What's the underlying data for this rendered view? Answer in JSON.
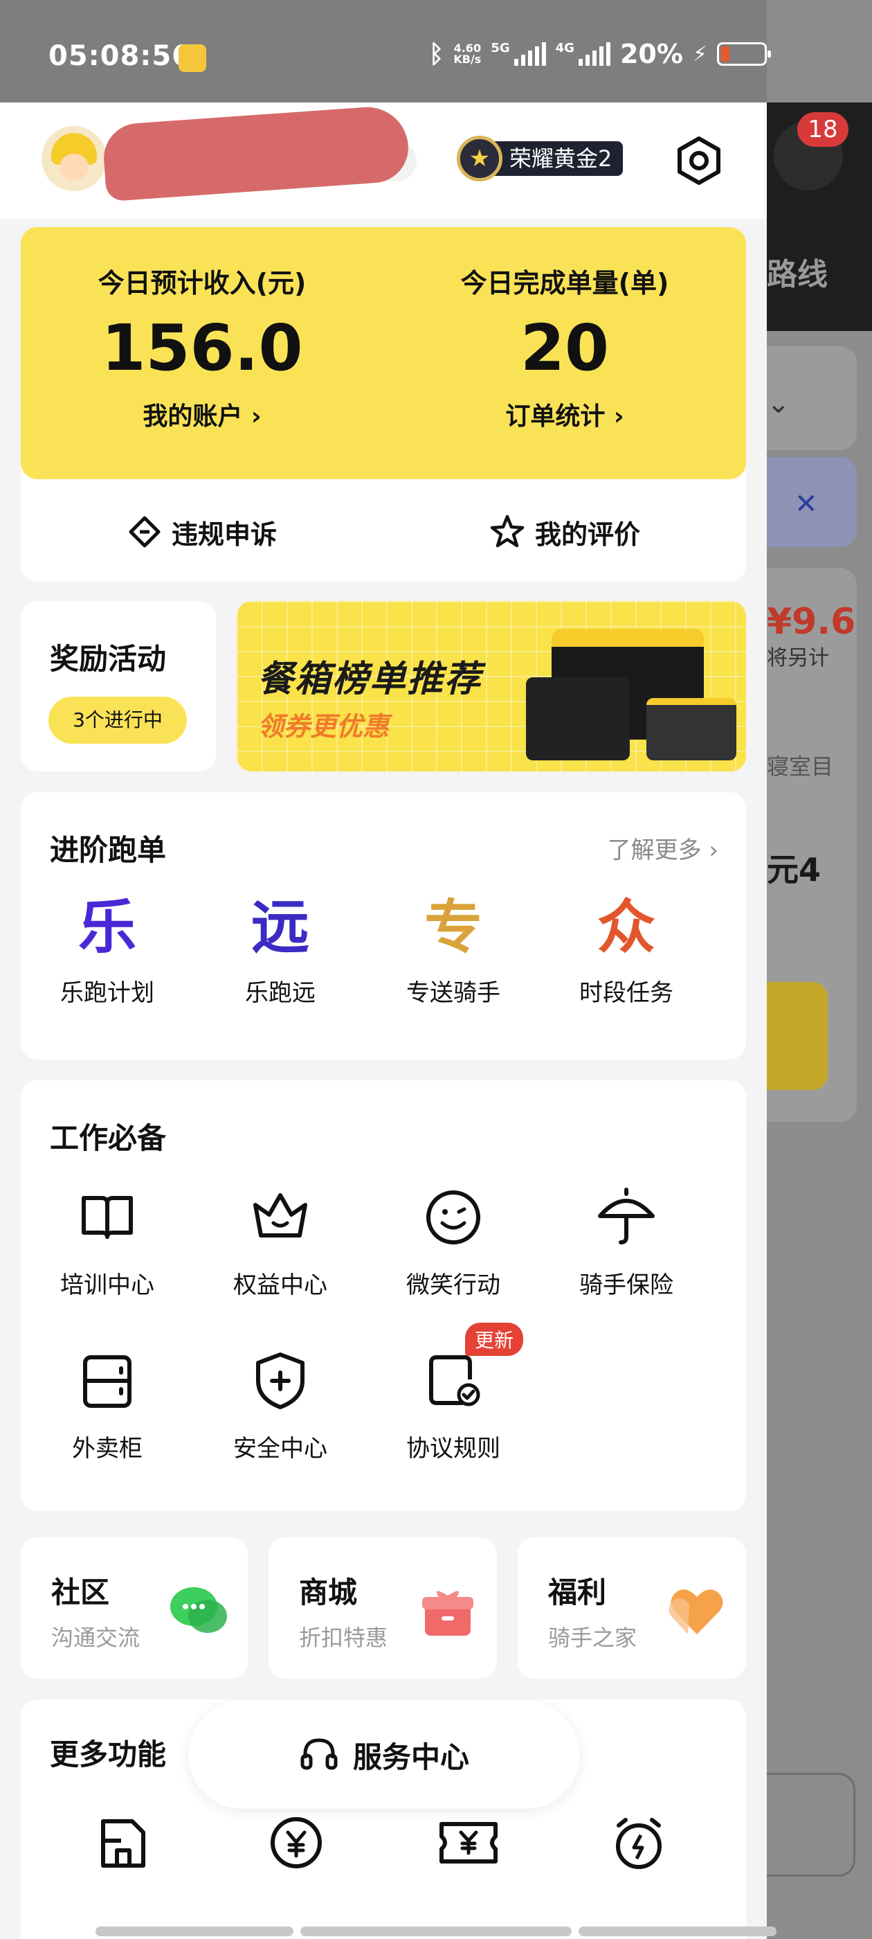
{
  "status_bar": {
    "time": "05:08:56",
    "net_speed_value": "4.60",
    "net_speed_unit": "KB/s",
    "net_5g": "5G",
    "net_4g": "4G",
    "battery_percent": "20%",
    "battery_level": 0.2,
    "battery_color": "#e85a2a"
  },
  "background_app": {
    "notification_count": "18",
    "route_text": "路线",
    "price": "¥9.6",
    "price_note": "将另计",
    "room_text": "寝室目",
    "amount_text": "元4"
  },
  "profile": {
    "rank_label": "荣耀黄金2"
  },
  "income": {
    "left_label": "今日预计收入(元)",
    "left_value": "156.0",
    "left_link": "我的账户 ›",
    "right_label": "今日完成单量(单)",
    "right_value": "20",
    "right_link": "订单统计 ›",
    "appeal": "违规申诉",
    "reviews": "我的评价"
  },
  "reward": {
    "title": "奖励活动",
    "pill": "3个进行中"
  },
  "banner": {
    "title": "餐箱榜单推荐",
    "subtitle": "领券更优惠"
  },
  "advanced": {
    "title": "进阶跑单",
    "more": "了解更多 ›",
    "items": [
      {
        "glyph": "乐",
        "label": "乐跑计划",
        "color": "#4a28d6"
      },
      {
        "glyph": "远",
        "label": "乐跑远",
        "color": "#3b2bc4"
      },
      {
        "glyph": "专",
        "label": "专送骑手",
        "color": "#d9a33a"
      },
      {
        "glyph": "众",
        "label": "时段任务",
        "color": "#e2562c"
      }
    ]
  },
  "work": {
    "title": "工作必备",
    "items": [
      {
        "icon": "book-icon",
        "label": "培训中心"
      },
      {
        "icon": "crown-icon",
        "label": "权益中心"
      },
      {
        "icon": "smile-icon",
        "label": "微笑行动"
      },
      {
        "icon": "umbrella-icon",
        "label": "骑手保险"
      },
      {
        "icon": "locker-icon",
        "label": "外卖柜"
      },
      {
        "icon": "shield-plus-icon",
        "label": "安全中心"
      },
      {
        "icon": "document-check-icon",
        "label": "协议规则"
      }
    ],
    "new_badge": "更新"
  },
  "community": [
    {
      "title": "社区",
      "subtitle": "沟通交流",
      "icon": "chat-bubbles-icon",
      "color": "#3ccf5e"
    },
    {
      "title": "商城",
      "subtitle": "折扣特惠",
      "icon": "gift-box-icon",
      "color": "#f06a6a"
    },
    {
      "title": "福利",
      "subtitle": "骑手之家",
      "icon": "heart-icon",
      "color": "#f5a24a"
    }
  ],
  "more_functions": {
    "title": "更多功能",
    "service_center": "服务中心",
    "icons": [
      "store-icon",
      "yen-coin-icon",
      "yen-ticket-icon",
      "alarm-bolt-icon"
    ]
  },
  "colors": {
    "accent_yellow": "#fae257",
    "new_badge": "#e34234"
  }
}
